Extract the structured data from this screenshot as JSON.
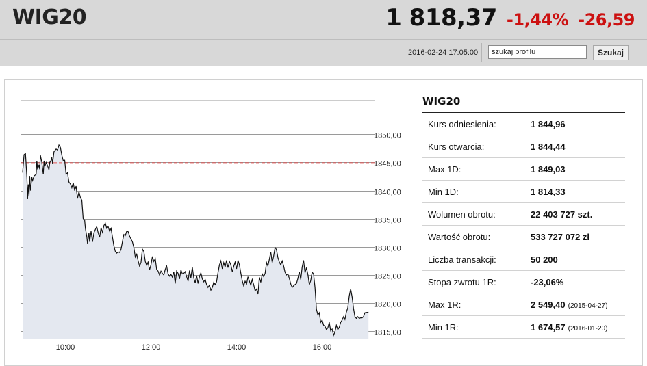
{
  "header": {
    "index_name": "WIG20",
    "price": "1 818,37",
    "change_pct": "-1,44%",
    "change_abs": "-26,59",
    "timestamp": "2016-02-24 17:05:00",
    "search_value": "szukaj profilu",
    "search_button": "Szukaj"
  },
  "colors": {
    "negative": "#cc1111",
    "header_bg": "#d8d8d8",
    "reference_line": "#e05555",
    "area_fill": "#e4e8f0"
  },
  "stats": {
    "title": "WIG20",
    "rows": [
      {
        "label": "Kurs odniesienia:",
        "value": "1 844,96",
        "date": ""
      },
      {
        "label": "Kurs otwarcia:",
        "value": "1 844,44",
        "date": ""
      },
      {
        "label": "Max 1D:",
        "value": "1 849,03",
        "date": ""
      },
      {
        "label": "Min 1D:",
        "value": "1 814,33",
        "date": ""
      },
      {
        "label": "Wolumen obrotu:",
        "value": "22 403 727 szt.",
        "date": ""
      },
      {
        "label": "Wartość obrotu:",
        "value": "533 727 072 zł",
        "date": ""
      },
      {
        "label": "Liczba transakcji:",
        "value": "50 200",
        "date": ""
      },
      {
        "label": "Stopa zwrotu 1R:",
        "value": "-23,06%",
        "date": ""
      },
      {
        "label": "Max 1R:",
        "value": "2 549,40",
        "date": "(2015-04-27)"
      },
      {
        "label": "Min 1R:",
        "value": "1 674,57",
        "date": "(2016-01-20)"
      }
    ]
  },
  "chart_data": {
    "type": "area",
    "x_ticks": [
      "10:00",
      "12:00",
      "14:00",
      "16:00"
    ],
    "y_ticks": [
      "1850,00",
      "1845,00",
      "1840,00",
      "1835,00",
      "1830,00",
      "1825,00",
      "1820,00",
      "1815,00"
    ],
    "y_tick_values": [
      1850,
      1845,
      1840,
      1835,
      1830,
      1825,
      1820,
      1815
    ],
    "ylim": [
      1813.7,
      1856
    ],
    "xlim": [
      "09:00",
      "17:15"
    ],
    "reference_value": 1844.96,
    "grid": true,
    "points": [
      [
        "09:00",
        1843.2
      ],
      [
        "09:02",
        1846.4
      ],
      [
        "09:04",
        1846.6
      ],
      [
        "09:06",
        1842.3
      ],
      [
        "09:07",
        1838.5
      ],
      [
        "09:08",
        1841.1
      ],
      [
        "09:09",
        1839.1
      ],
      [
        "09:10",
        1842.6
      ],
      [
        "09:11",
        1840.0
      ],
      [
        "09:13",
        1842.4
      ],
      [
        "09:14",
        1841.8
      ],
      [
        "09:16",
        1842.6
      ],
      [
        "09:19",
        1842.9
      ],
      [
        "09:20",
        1845.3
      ],
      [
        "09:21",
        1843.8
      ],
      [
        "09:23",
        1844.6
      ],
      [
        "09:24",
        1843.8
      ],
      [
        "09:25",
        1846.3
      ],
      [
        "09:27",
        1845.0
      ],
      [
        "09:29",
        1842.9
      ],
      [
        "09:30",
        1845.3
      ],
      [
        "09:31",
        1844.3
      ],
      [
        "09:33",
        1845.0
      ],
      [
        "09:35",
        1844.4
      ],
      [
        "09:37",
        1843.7
      ],
      [
        "09:38",
        1845.0
      ],
      [
        "09:40",
        1845.4
      ],
      [
        "09:41",
        1845.9
      ],
      [
        "09:42",
        1844.8
      ],
      [
        "09:44",
        1846.9
      ],
      [
        "09:47",
        1847.4
      ],
      [
        "09:49",
        1847.2
      ],
      [
        "09:51",
        1848.1
      ],
      [
        "09:53",
        1847.7
      ],
      [
        "09:55",
        1846.3
      ],
      [
        "09:57",
        1845.3
      ],
      [
        "09:59",
        1845.4
      ],
      [
        "10:01",
        1842.9
      ],
      [
        "10:03",
        1843.2
      ],
      [
        "10:05",
        1841.5
      ],
      [
        "10:07",
        1841.2
      ],
      [
        "10:09",
        1840.5
      ],
      [
        "10:11",
        1841.4
      ],
      [
        "10:13",
        1840.0
      ],
      [
        "10:15",
        1840.8
      ],
      [
        "10:17",
        1838.6
      ],
      [
        "10:19",
        1839.8
      ],
      [
        "10:21",
        1838.8
      ],
      [
        "10:23",
        1838.3
      ],
      [
        "10:25",
        1835.0
      ],
      [
        "10:27",
        1834.8
      ],
      [
        "10:28",
        1833.3
      ],
      [
        "10:30",
        1831.8
      ],
      [
        "10:31",
        1830.6
      ],
      [
        "10:33",
        1832.5
      ],
      [
        "10:34",
        1830.9
      ],
      [
        "10:36",
        1832.8
      ],
      [
        "10:38",
        1830.9
      ],
      [
        "10:40",
        1832.5
      ],
      [
        "10:42",
        1833.1
      ],
      [
        "10:44",
        1833.6
      ],
      [
        "10:46",
        1832.5
      ],
      [
        "10:48",
        1831.7
      ],
      [
        "10:50",
        1833.4
      ],
      [
        "10:52",
        1832.6
      ],
      [
        "10:54",
        1833.8
      ],
      [
        "10:56",
        1834.2
      ],
      [
        "10:58",
        1833.3
      ],
      [
        "11:00",
        1833.6
      ],
      [
        "11:02",
        1832.8
      ],
      [
        "11:04",
        1833.3
      ],
      [
        "11:06",
        1831.7
      ],
      [
        "11:08",
        1830.2
      ],
      [
        "11:10",
        1829.2
      ],
      [
        "11:12",
        1828.9
      ],
      [
        "11:14",
        1829.1
      ],
      [
        "11:16",
        1829.0
      ],
      [
        "11:18",
        1829.6
      ],
      [
        "11:20",
        1830.9
      ],
      [
        "11:22",
        1832.2
      ],
      [
        "11:24",
        1832.0
      ],
      [
        "11:26",
        1832.8
      ],
      [
        "11:28",
        1832.7
      ],
      [
        "11:30",
        1831.9
      ],
      [
        "11:32",
        1831.4
      ],
      [
        "11:34",
        1830.9
      ],
      [
        "11:36",
        1829.9
      ],
      [
        "11:38",
        1828.2
      ],
      [
        "11:40",
        1828.7
      ],
      [
        "11:42",
        1827.5
      ],
      [
        "11:44",
        1826.6
      ],
      [
        "11:46",
        1827.2
      ],
      [
        "11:48",
        1829.6
      ],
      [
        "11:50",
        1829.2
      ],
      [
        "11:52",
        1827.4
      ],
      [
        "11:54",
        1826.7
      ],
      [
        "11:56",
        1827.3
      ],
      [
        "11:58",
        1825.9
      ],
      [
        "12:00",
        1826.8
      ],
      [
        "12:02",
        1828.3
      ],
      [
        "12:04",
        1827.4
      ],
      [
        "12:06",
        1827.9
      ],
      [
        "12:08",
        1826.0
      ],
      [
        "12:10",
        1825.7
      ],
      [
        "12:12",
        1825.0
      ],
      [
        "12:14",
        1825.7
      ],
      [
        "12:16",
        1825.3
      ],
      [
        "12:18",
        1825.0
      ],
      [
        "12:20",
        1826.0
      ],
      [
        "12:22",
        1826.6
      ],
      [
        "12:24",
        1825.2
      ],
      [
        "12:26",
        1824.8
      ],
      [
        "12:28",
        1825.1
      ],
      [
        "12:30",
        1824.6
      ],
      [
        "12:32",
        1825.6
      ],
      [
        "12:34",
        1823.5
      ],
      [
        "12:36",
        1825.7
      ],
      [
        "12:38",
        1825.3
      ],
      [
        "12:40",
        1824.3
      ],
      [
        "12:42",
        1825.9
      ],
      [
        "12:44",
        1825.2
      ],
      [
        "12:46",
        1825.3
      ],
      [
        "12:48",
        1825.6
      ],
      [
        "12:50",
        1824.7
      ],
      [
        "12:52",
        1823.9
      ],
      [
        "12:54",
        1825.8
      ],
      [
        "12:56",
        1824.5
      ],
      [
        "12:58",
        1826.4
      ],
      [
        "13:00",
        1824.5
      ],
      [
        "13:02",
        1823.6
      ],
      [
        "13:04",
        1824.9
      ],
      [
        "13:06",
        1823.5
      ],
      [
        "13:08",
        1824.7
      ],
      [
        "13:10",
        1825.4
      ],
      [
        "13:12",
        1824.3
      ],
      [
        "13:14",
        1823.8
      ],
      [
        "13:16",
        1824.2
      ],
      [
        "13:18",
        1823.3
      ],
      [
        "13:20",
        1822.8
      ],
      [
        "13:22",
        1823.2
      ],
      [
        "13:24",
        1822.3
      ],
      [
        "13:26",
        1822.8
      ],
      [
        "13:28",
        1823.7
      ],
      [
        "13:30",
        1823.3
      ],
      [
        "13:32",
        1823.8
      ],
      [
        "13:34",
        1825.4
      ],
      [
        "13:36",
        1826.8
      ],
      [
        "13:38",
        1827.5
      ],
      [
        "13:40",
        1826.1
      ],
      [
        "13:42",
        1827.2
      ],
      [
        "13:44",
        1826.4
      ],
      [
        "13:46",
        1827.6
      ],
      [
        "13:48",
        1826.3
      ],
      [
        "13:50",
        1827.4
      ],
      [
        "13:52",
        1826.8
      ],
      [
        "13:54",
        1825.6
      ],
      [
        "13:56",
        1826.5
      ],
      [
        "13:58",
        1827.3
      ],
      [
        "14:00",
        1826.1
      ],
      [
        "14:02",
        1827.6
      ],
      [
        "14:04",
        1826.8
      ],
      [
        "14:06",
        1825.3
      ],
      [
        "14:08",
        1824.0
      ],
      [
        "14:10",
        1823.1
      ],
      [
        "14:12",
        1823.9
      ],
      [
        "14:14",
        1823.4
      ],
      [
        "14:16",
        1824.7
      ],
      [
        "14:18",
        1823.9
      ],
      [
        "14:20",
        1823.2
      ],
      [
        "14:22",
        1824.2
      ],
      [
        "14:24",
        1823.3
      ],
      [
        "14:26",
        1822.2
      ],
      [
        "14:28",
        1822.5
      ],
      [
        "14:30",
        1821.6
      ],
      [
        "14:32",
        1824.6
      ],
      [
        "14:34",
        1823.7
      ],
      [
        "14:36",
        1825.2
      ],
      [
        "14:38",
        1824.7
      ],
      [
        "14:40",
        1825.3
      ],
      [
        "14:42",
        1827.2
      ],
      [
        "14:44",
        1826.6
      ],
      [
        "14:46",
        1827.8
      ],
      [
        "14:48",
        1829.1
      ],
      [
        "14:50",
        1827.2
      ],
      [
        "14:52",
        1828.4
      ],
      [
        "14:54",
        1829.9
      ],
      [
        "14:56",
        1829.5
      ],
      [
        "14:58",
        1828.1
      ],
      [
        "15:00",
        1827.3
      ],
      [
        "15:02",
        1826.8
      ],
      [
        "15:04",
        1827.5
      ],
      [
        "15:06",
        1826.6
      ],
      [
        "15:08",
        1825.5
      ],
      [
        "15:10",
        1825.0
      ],
      [
        "15:12",
        1825.2
      ],
      [
        "15:14",
        1824.4
      ],
      [
        "15:16",
        1823.4
      ],
      [
        "15:18",
        1822.8
      ],
      [
        "15:20",
        1823.1
      ],
      [
        "15:22",
        1823.3
      ],
      [
        "15:24",
        1823.5
      ],
      [
        "15:26",
        1824.4
      ],
      [
        "15:28",
        1825.6
      ],
      [
        "15:30",
        1824.2
      ],
      [
        "15:32",
        1826.4
      ],
      [
        "15:34",
        1827.6
      ],
      [
        "15:36",
        1825.4
      ],
      [
        "15:38",
        1826.3
      ],
      [
        "15:40",
        1825.1
      ],
      [
        "15:42",
        1823.3
      ],
      [
        "15:44",
        1824.0
      ],
      [
        "15:46",
        1825.5
      ],
      [
        "15:48",
        1825.2
      ],
      [
        "15:50",
        1822.8
      ],
      [
        "15:52",
        1818.9
      ],
      [
        "15:54",
        1817.9
      ],
      [
        "15:56",
        1818.3
      ],
      [
        "15:58",
        1816.6
      ],
      [
        "16:00",
        1817.0
      ],
      [
        "16:02",
        1816.1
      ],
      [
        "16:04",
        1815.9
      ],
      [
        "16:06",
        1815.3
      ],
      [
        "16:08",
        1815.6
      ],
      [
        "16:10",
        1816.6
      ],
      [
        "16:12",
        1815.1
      ],
      [
        "16:14",
        1815.4
      ],
      [
        "16:16",
        1814.3
      ],
      [
        "16:18",
        1814.9
      ],
      [
        "16:20",
        1816.1
      ],
      [
        "16:22",
        1815.3
      ],
      [
        "16:24",
        1815.7
      ],
      [
        "16:26",
        1816.6
      ],
      [
        "16:28",
        1817.0
      ],
      [
        "16:30",
        1817.6
      ],
      [
        "16:32",
        1817.1
      ],
      [
        "16:34",
        1818.4
      ],
      [
        "16:36",
        1819.2
      ],
      [
        "16:38",
        1821.3
      ],
      [
        "16:40",
        1822.5
      ],
      [
        "16:42",
        1821.1
      ],
      [
        "16:44",
        1819.1
      ],
      [
        "16:46",
        1817.6
      ],
      [
        "16:48",
        1817.3
      ],
      [
        "16:50",
        1817.6
      ],
      [
        "16:52",
        1817.3
      ],
      [
        "16:54",
        1817.4
      ],
      [
        "16:56",
        1817.4
      ],
      [
        "16:58",
        1817.6
      ],
      [
        "17:00",
        1818.3
      ],
      [
        "17:05",
        1818.4
      ]
    ]
  }
}
